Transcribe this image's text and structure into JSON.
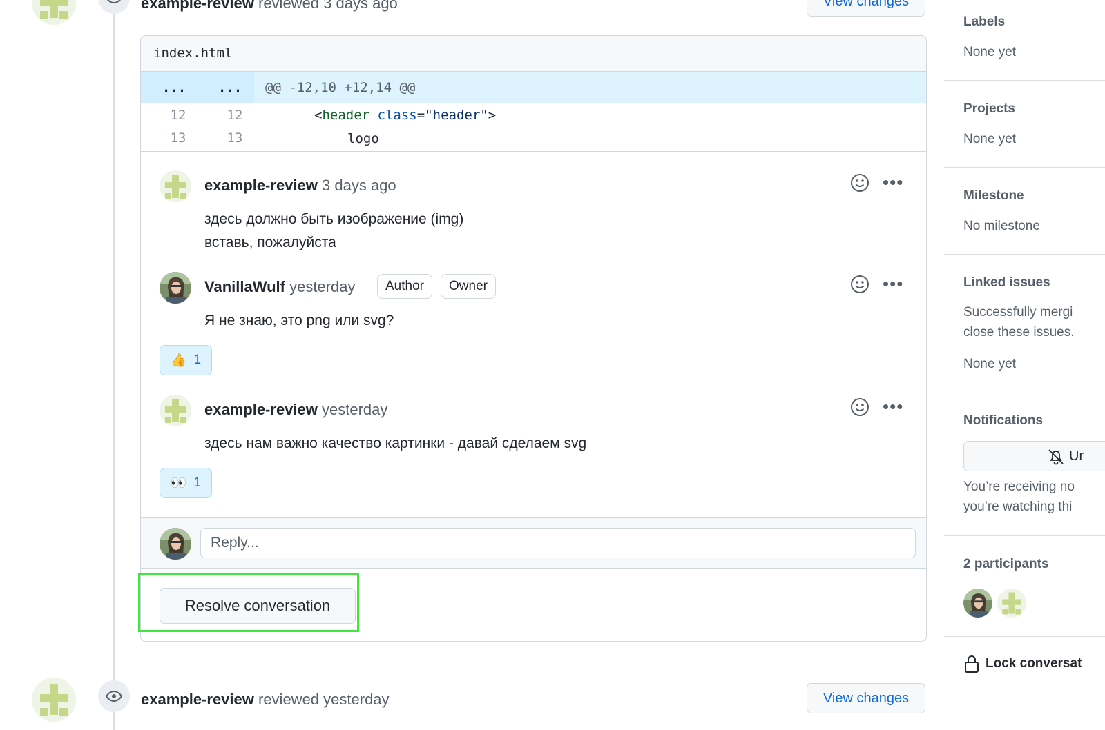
{
  "timeline": {
    "top_review": {
      "author": "example-review",
      "action": "reviewed 3 days ago",
      "view_label": "View changes"
    },
    "bottom_review": {
      "author": "example-review",
      "action": "reviewed yesterday",
      "view_label": "View changes"
    }
  },
  "diff": {
    "filename": "index.html",
    "hunk_left": "...",
    "hunk_right": "...",
    "hunk_header": "@@ -12,10 +12,14 @@",
    "lines": [
      {
        "old": "12",
        "new": "12"
      },
      {
        "old": "13",
        "new": "13"
      }
    ],
    "line1": {
      "open": "<",
      "tag": "header",
      "attr": "class",
      "eq": "=",
      "value": "\"header\"",
      "close": ">"
    },
    "line2": "logo"
  },
  "comments": [
    {
      "author": "example-review",
      "time": "3 days ago",
      "body_line1": "здесь должно быть изображение (img)",
      "body_line2": "вставь, пожалуйста"
    },
    {
      "author": "VanillaWulf",
      "time": "yesterday",
      "badge_author": "Author",
      "badge_owner": "Owner",
      "body": "Я не знаю, это png или svg?",
      "reaction_emoji": "👍",
      "reaction_count": "1"
    },
    {
      "author": "example-review",
      "time": "yesterday",
      "body": "здесь нам важно качество картинки - давай сделаем svg",
      "reaction_emoji": "👀",
      "reaction_count": "1"
    }
  ],
  "more_label": "•••",
  "reply": {
    "placeholder": "Reply..."
  },
  "resolve_label": "Resolve conversation",
  "sidebar": {
    "labels_title": "Labels",
    "labels_value": "None yet",
    "projects_title": "Projects",
    "projects_value": "None yet",
    "milestone_title": "Milestone",
    "milestone_value": "No milestone",
    "linked_title": "Linked issues",
    "linked_desc1": "Successfully mergi",
    "linked_desc2": "close these issues.",
    "linked_value": "None yet",
    "notifications_title": "Notifications",
    "notif_button": "Ur",
    "notif_desc1": "You’re receiving no",
    "notif_desc2": "you’re watching thi",
    "participants_title": "2 participants",
    "lock_label": "Lock conversat"
  },
  "colors": {
    "accent": "#0969da",
    "highlight": "#3ee63e",
    "hunk_bg": "#ddf4ff",
    "avatar_green": "#c5d88a"
  }
}
